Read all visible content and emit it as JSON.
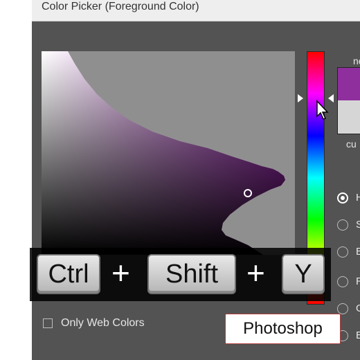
{
  "window": {
    "title": "Color Picker (Foreground Color)"
  },
  "color_field": {
    "hue": "purple/magenta",
    "selected_color": "#8f2f9e"
  },
  "hue_slider": {
    "top_color": "#ff0000"
  },
  "swatches": {
    "new_label": "ne",
    "current_label": "cu",
    "new_color": "#8f2f9e",
    "current_color": "#d6d6d6"
  },
  "color_modes": [
    {
      "letter": "H",
      "checked": true
    },
    {
      "letter": "S",
      "checked": false
    },
    {
      "letter": "B",
      "checked": false
    },
    {
      "letter": "R",
      "checked": false
    },
    {
      "letter": "G",
      "checked": false
    },
    {
      "letter": "B",
      "checked": false
    }
  ],
  "options": {
    "only_web_colors_label": "Only Web Colors"
  },
  "shortcut": {
    "key1": "Ctrl",
    "plus": "+",
    "key2": "Shift",
    "key3": "Y"
  },
  "badge": {
    "label": "Photoshop"
  }
}
